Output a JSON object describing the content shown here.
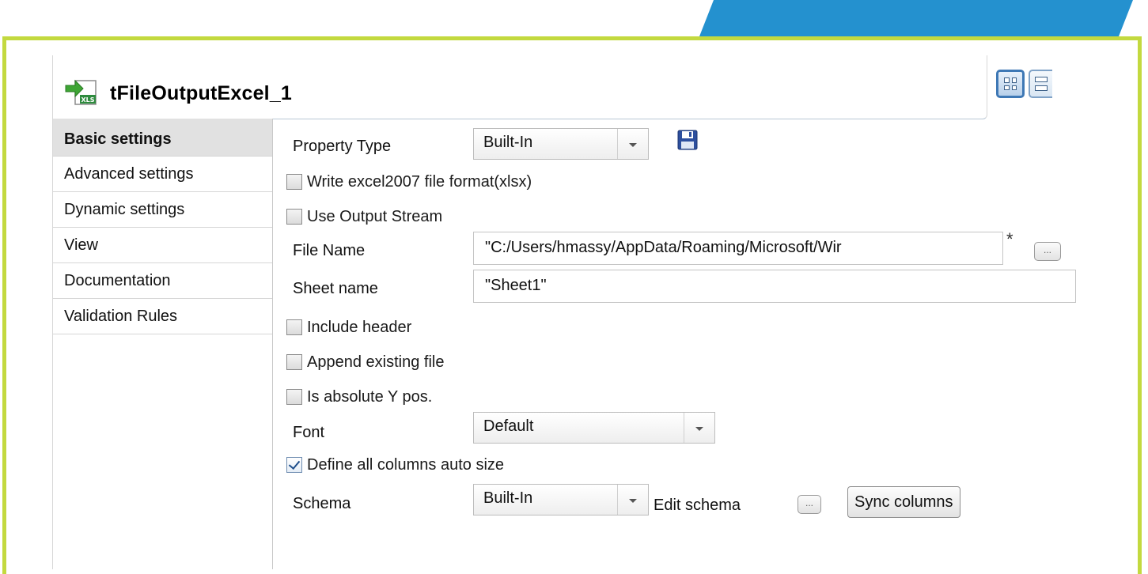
{
  "colors": {
    "frame": "#c3d93f",
    "accent_bar": "#2491cf"
  },
  "component": {
    "icon": "xls-file-output-icon",
    "title": "tFileOutputExcel_1"
  },
  "view_buttons": [
    {
      "icon": "grid-layout-icon",
      "active": true
    },
    {
      "icon": "rows-layout-icon",
      "active": false
    }
  ],
  "nav": {
    "items": [
      {
        "label": "Basic settings",
        "active": true
      },
      {
        "label": "Advanced settings"
      },
      {
        "label": "Dynamic settings"
      },
      {
        "label": "View"
      },
      {
        "label": "Documentation"
      },
      {
        "label": "Validation Rules"
      }
    ]
  },
  "form": {
    "property_type": {
      "label": "Property Type",
      "value": "Built-In",
      "save_icon": "save-icon"
    },
    "write_excel2007": {
      "label": "Write excel2007 file format(xlsx)",
      "checked": false
    },
    "use_output_stream": {
      "label": "Use Output Stream",
      "checked": false
    },
    "file_name": {
      "label": "File Name",
      "value": "\"C:/Users/hmassy/AppData/Roaming/Microsoft/Wir",
      "required_mark": "*",
      "browse": "..."
    },
    "sheet_name": {
      "label": "Sheet name",
      "value": "\"Sheet1\""
    },
    "include_header": {
      "label": "Include header",
      "checked": false
    },
    "append_existing": {
      "label": "Append existing file",
      "checked": false
    },
    "absolute_y": {
      "label": "Is absolute Y pos.",
      "checked": false
    },
    "font": {
      "label": "Font",
      "value": "Default"
    },
    "auto_size": {
      "label": "Define all columns auto size",
      "checked": true
    },
    "schema": {
      "label": "Schema",
      "value": "Built-In",
      "edit_label": "Edit schema",
      "edit_btn": "...",
      "sync_btn": "Sync columns"
    }
  }
}
